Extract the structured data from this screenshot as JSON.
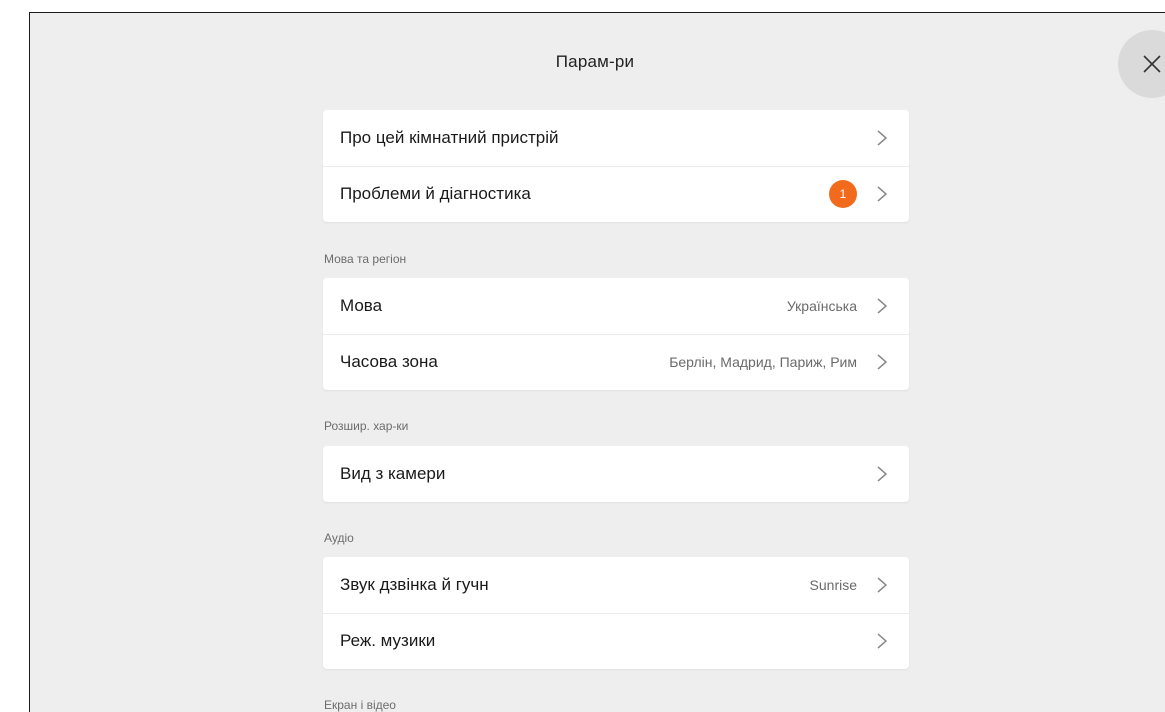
{
  "title": "Парам-ри",
  "close": {
    "icon": "close-icon"
  },
  "groups": [
    {
      "rows": [
        {
          "label": "Про цей кімнатний пристрій",
          "value": ""
        },
        {
          "label": "Проблеми й діагностика",
          "badge": "1"
        }
      ]
    },
    {
      "heading": "Мова та регіон",
      "rows": [
        {
          "label": "Мова",
          "value": "Українська"
        },
        {
          "label": "Часова зона",
          "value": "Берлін, Мадрид, Париж, Рим"
        }
      ]
    },
    {
      "heading": "Розшир. хар-ки",
      "rows": [
        {
          "label": "Вид з камери",
          "value": ""
        }
      ]
    },
    {
      "heading": "Аудіо",
      "rows": [
        {
          "label": "Звук дзвінка й гучн",
          "value": "Sunrise"
        },
        {
          "label": "Реж. музики",
          "value": ""
        }
      ]
    },
    {
      "heading": "Екран і відео",
      "rows": []
    }
  ],
  "colors": {
    "background": "#eeeeee",
    "card": "#ffffff",
    "badge": "#f26b1d",
    "close_button": "#dadada"
  }
}
